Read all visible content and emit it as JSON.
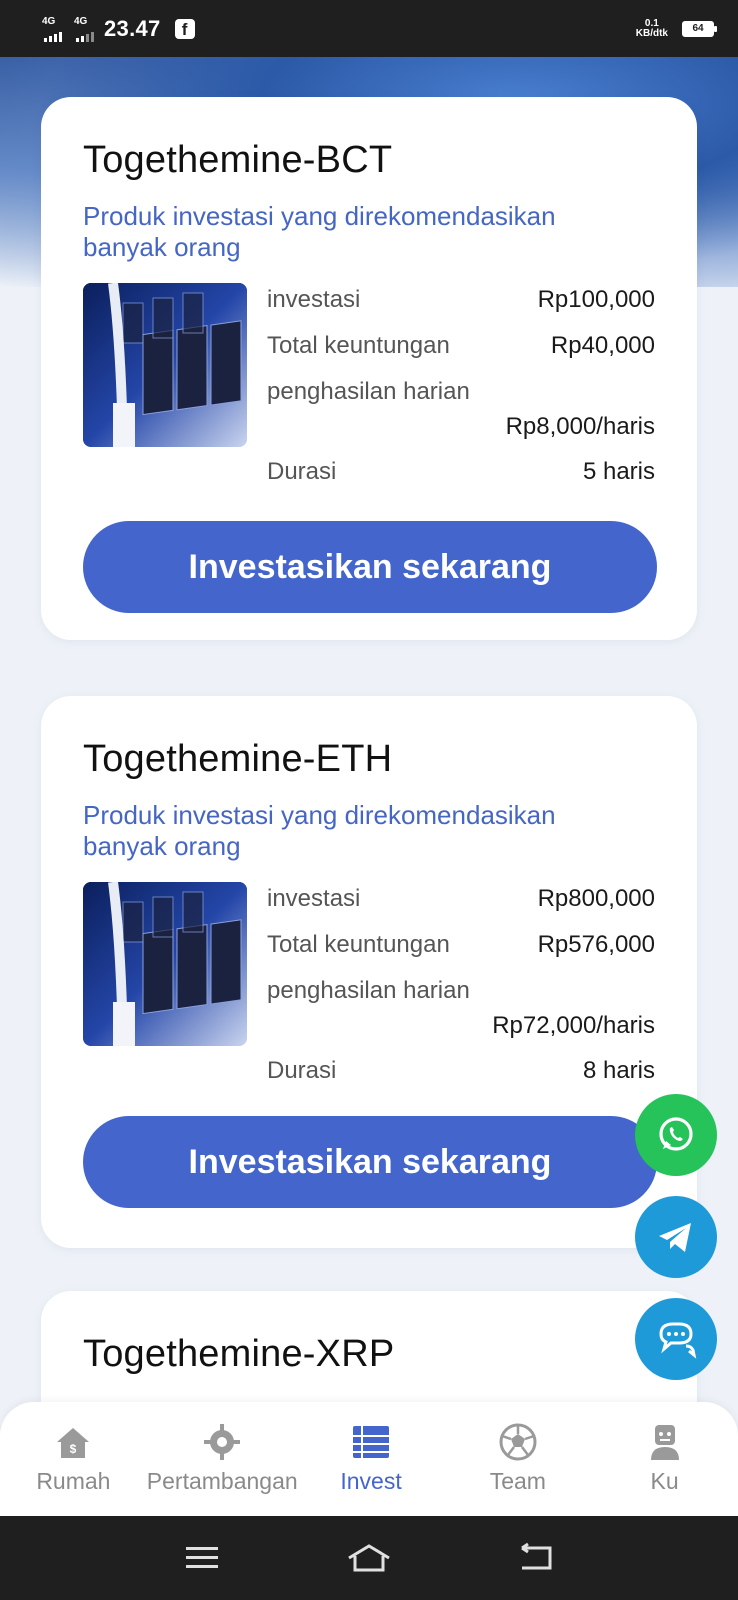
{
  "status_bar": {
    "signal1": "4G",
    "signal2": "4G",
    "time": "23.47",
    "net_speed_top": "0.1",
    "net_speed_bottom": "KB/dtk",
    "battery": "64"
  },
  "products": [
    {
      "title": "Togethemine-BCT",
      "subtitle": "Produk investasi yang direkomendasikan banyak orang",
      "investasi_label": "investasi",
      "investasi_value": "Rp100,000",
      "keuntungan_label": "Total keuntungan",
      "keuntungan_value": "Rp40,000",
      "harian_label": "penghasilan harian",
      "harian_value": "Rp8,000/haris",
      "durasi_label": "Durasi",
      "durasi_value": "5 haris",
      "button": "Investasikan sekarang"
    },
    {
      "title": "Togethemine-ETH",
      "subtitle": "Produk investasi yang direkomendasikan banyak orang",
      "investasi_label": "investasi",
      "investasi_value": "Rp800,000",
      "keuntungan_label": "Total keuntungan",
      "keuntungan_value": "Rp576,000",
      "harian_label": "penghasilan harian",
      "harian_value": "Rp72,000/haris",
      "durasi_label": "Durasi",
      "durasi_value": "8 haris",
      "button": "Investasikan sekarang"
    },
    {
      "title": "Togethemine-XRP"
    }
  ],
  "floating": [
    "whatsapp-icon",
    "telegram-icon",
    "chat-icon"
  ],
  "nav": {
    "items": [
      {
        "label": "Rumah",
        "icon": "home-icon"
      },
      {
        "label": "Pertambangan",
        "icon": "mining-icon"
      },
      {
        "label": "Invest",
        "icon": "list-icon"
      },
      {
        "label": "Team",
        "icon": "football-icon"
      },
      {
        "label": "Ku",
        "icon": "user-icon"
      }
    ],
    "active": "Invest"
  },
  "colors": {
    "accent": "#4466cc",
    "whatsapp": "#25c35a",
    "telegram": "#1f9ad8",
    "chat": "#1f9ad8"
  }
}
